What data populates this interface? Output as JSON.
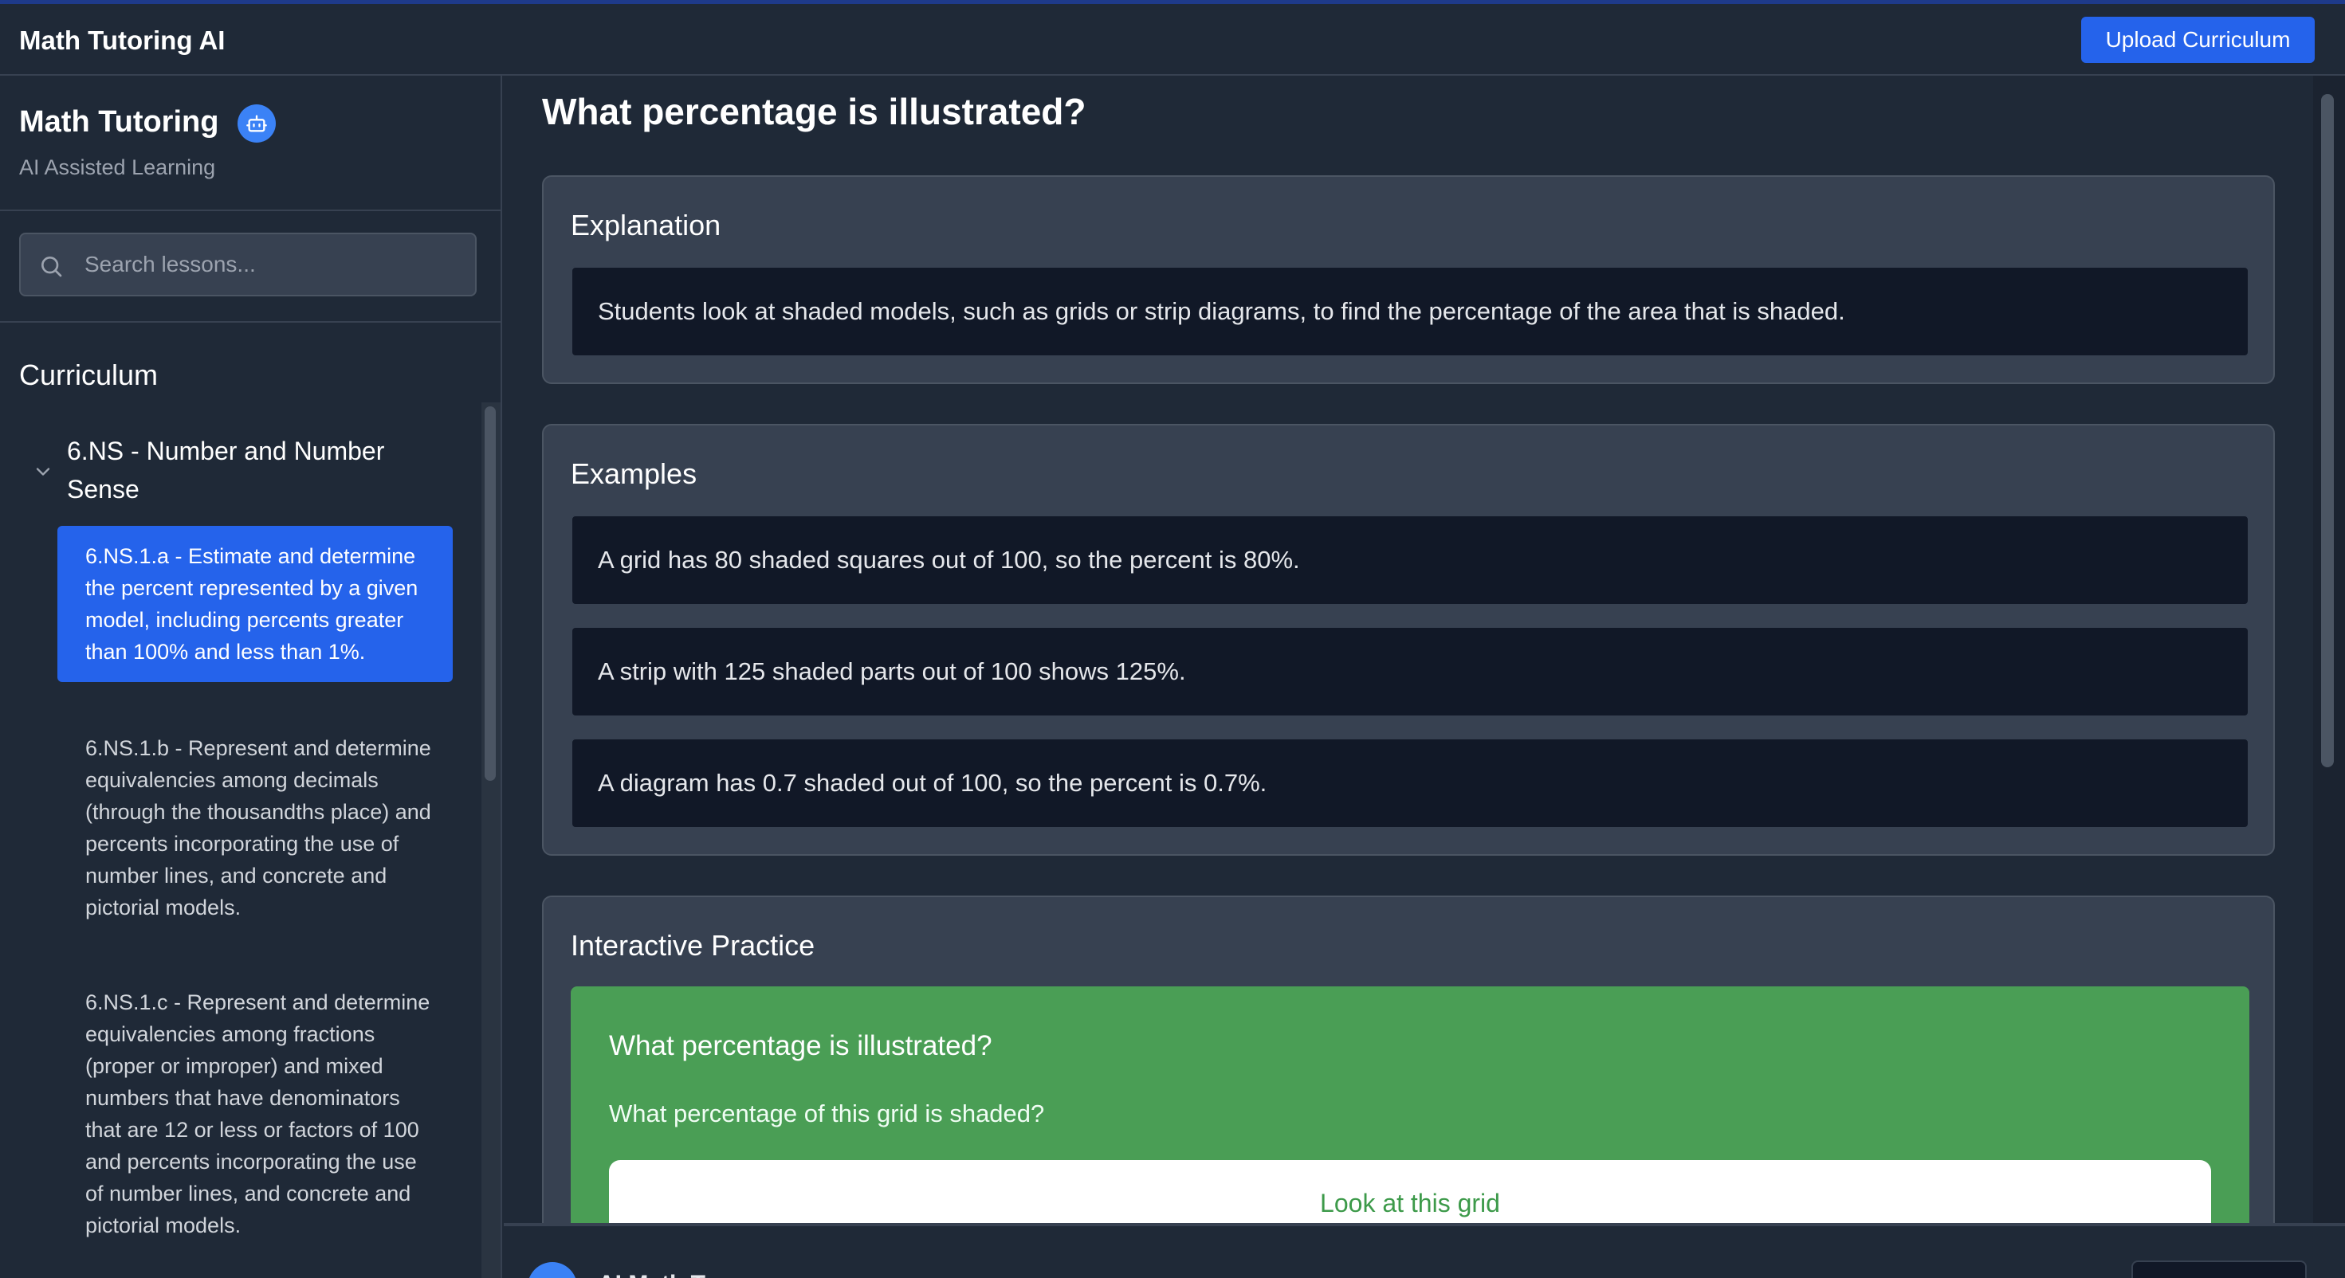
{
  "app": {
    "title": "Math Tutoring AI",
    "upload_label": "Upload Curriculum",
    "accent_color": "#2563eb"
  },
  "sidebar": {
    "title": "Math Tutoring",
    "title_icon": "robot-icon",
    "subtitle": "AI Assisted Learning",
    "search": {
      "placeholder": "Search lessons...",
      "value": ""
    },
    "curriculum_heading": "Curriculum",
    "group": {
      "label": "6.NS - Number and Number Sense",
      "expanded": true,
      "lessons": [
        {
          "label": "6.NS.1.a - Estimate and determine the percent represented by a given model, including percents greater than 100% and less than 1%.",
          "active": true
        },
        {
          "label": "6.NS.1.b - Represent and determine equivalencies among decimals (through the thousandths place) and percents incorporating the use of number lines, and concrete and pictorial models.",
          "active": false
        },
        {
          "label": "6.NS.1.c - Represent and determine equivalencies among fractions (proper or improper) and mixed numbers that have denominators that are 12 or less or factors of 100 and percents incorporating the use of number lines, and concrete and pictorial models.",
          "active": false
        }
      ]
    }
  },
  "main": {
    "page_title": "What percentage is illustrated?",
    "explanation": {
      "heading": "Explanation",
      "text": "Students look at shaded models, such as grids or strip diagrams, to find the percentage of the area that is shaded."
    },
    "examples": {
      "heading": "Examples",
      "items": [
        "A grid has 80 shaded squares out of 100, so the percent is 80%.",
        "A strip with 125 shaded parts out of 100 shows 125%.",
        "A diagram has 0.7 shaded out of 100, so the percent is 0.7%."
      ]
    },
    "practice": {
      "heading": "Interactive Practice",
      "card_title": "What percentage is illustrated?",
      "question": "What percentage of this grid is shaded?",
      "grid_title": "Look at this grid",
      "card_color": "#4a9e55"
    }
  },
  "chat": {
    "name": "AI Math T..."
  }
}
